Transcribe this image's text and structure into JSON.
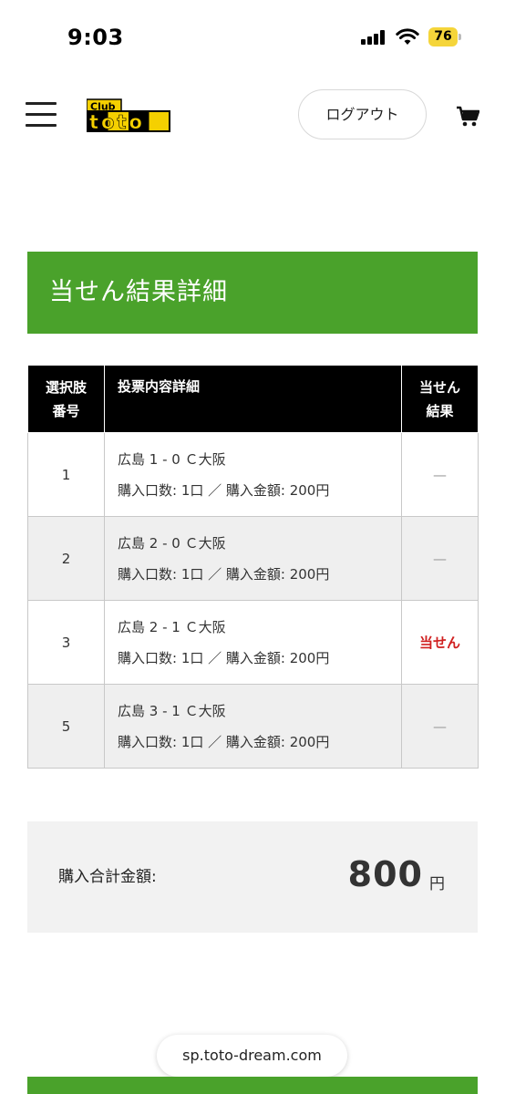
{
  "status_bar": {
    "time": "9:03",
    "battery": "76",
    "icons": [
      "signal-icon",
      "wifi-icon",
      "battery-icon"
    ]
  },
  "header": {
    "logo_top": "Club",
    "logo_main": "toto",
    "logout_label": "ログアウト",
    "icons": [
      "hamburger-menu-icon",
      "cart-icon"
    ]
  },
  "page": {
    "title": "当せん結果詳細"
  },
  "table": {
    "headers": {
      "number_line1": "選択肢",
      "number_line2": "番号",
      "detail": "投票内容詳細",
      "result_line1": "当せん",
      "result_line2": "結果"
    },
    "rows": [
      {
        "number": "1",
        "match": "広島 1 - 0 Ｃ大阪",
        "purchase": "購入口数: 1口 ／ 購入金額: 200円",
        "result": "—"
      },
      {
        "number": "2",
        "match": "広島 2 - 0 Ｃ大阪",
        "purchase": "購入口数: 1口 ／ 購入金額: 200円",
        "result": "—"
      },
      {
        "number": "3",
        "match": "広島 2 - 1 Ｃ大阪",
        "purchase": "購入口数: 1口 ／ 購入金額: 200円",
        "result": "当せん"
      },
      {
        "number": "5",
        "match": "広島 3 - 1 Ｃ大阪",
        "purchase": "購入口数: 1口 ／ 購入金額: 200円",
        "result": "—"
      }
    ]
  },
  "total": {
    "label": "購入合計金額:",
    "amount": "800",
    "unit": "円"
  },
  "browser": {
    "url": "sp.toto-dream.com"
  },
  "colors": {
    "brand_green": "#4aa22b",
    "win_red": "#d02020",
    "logo_yellow": "#f5d000"
  }
}
